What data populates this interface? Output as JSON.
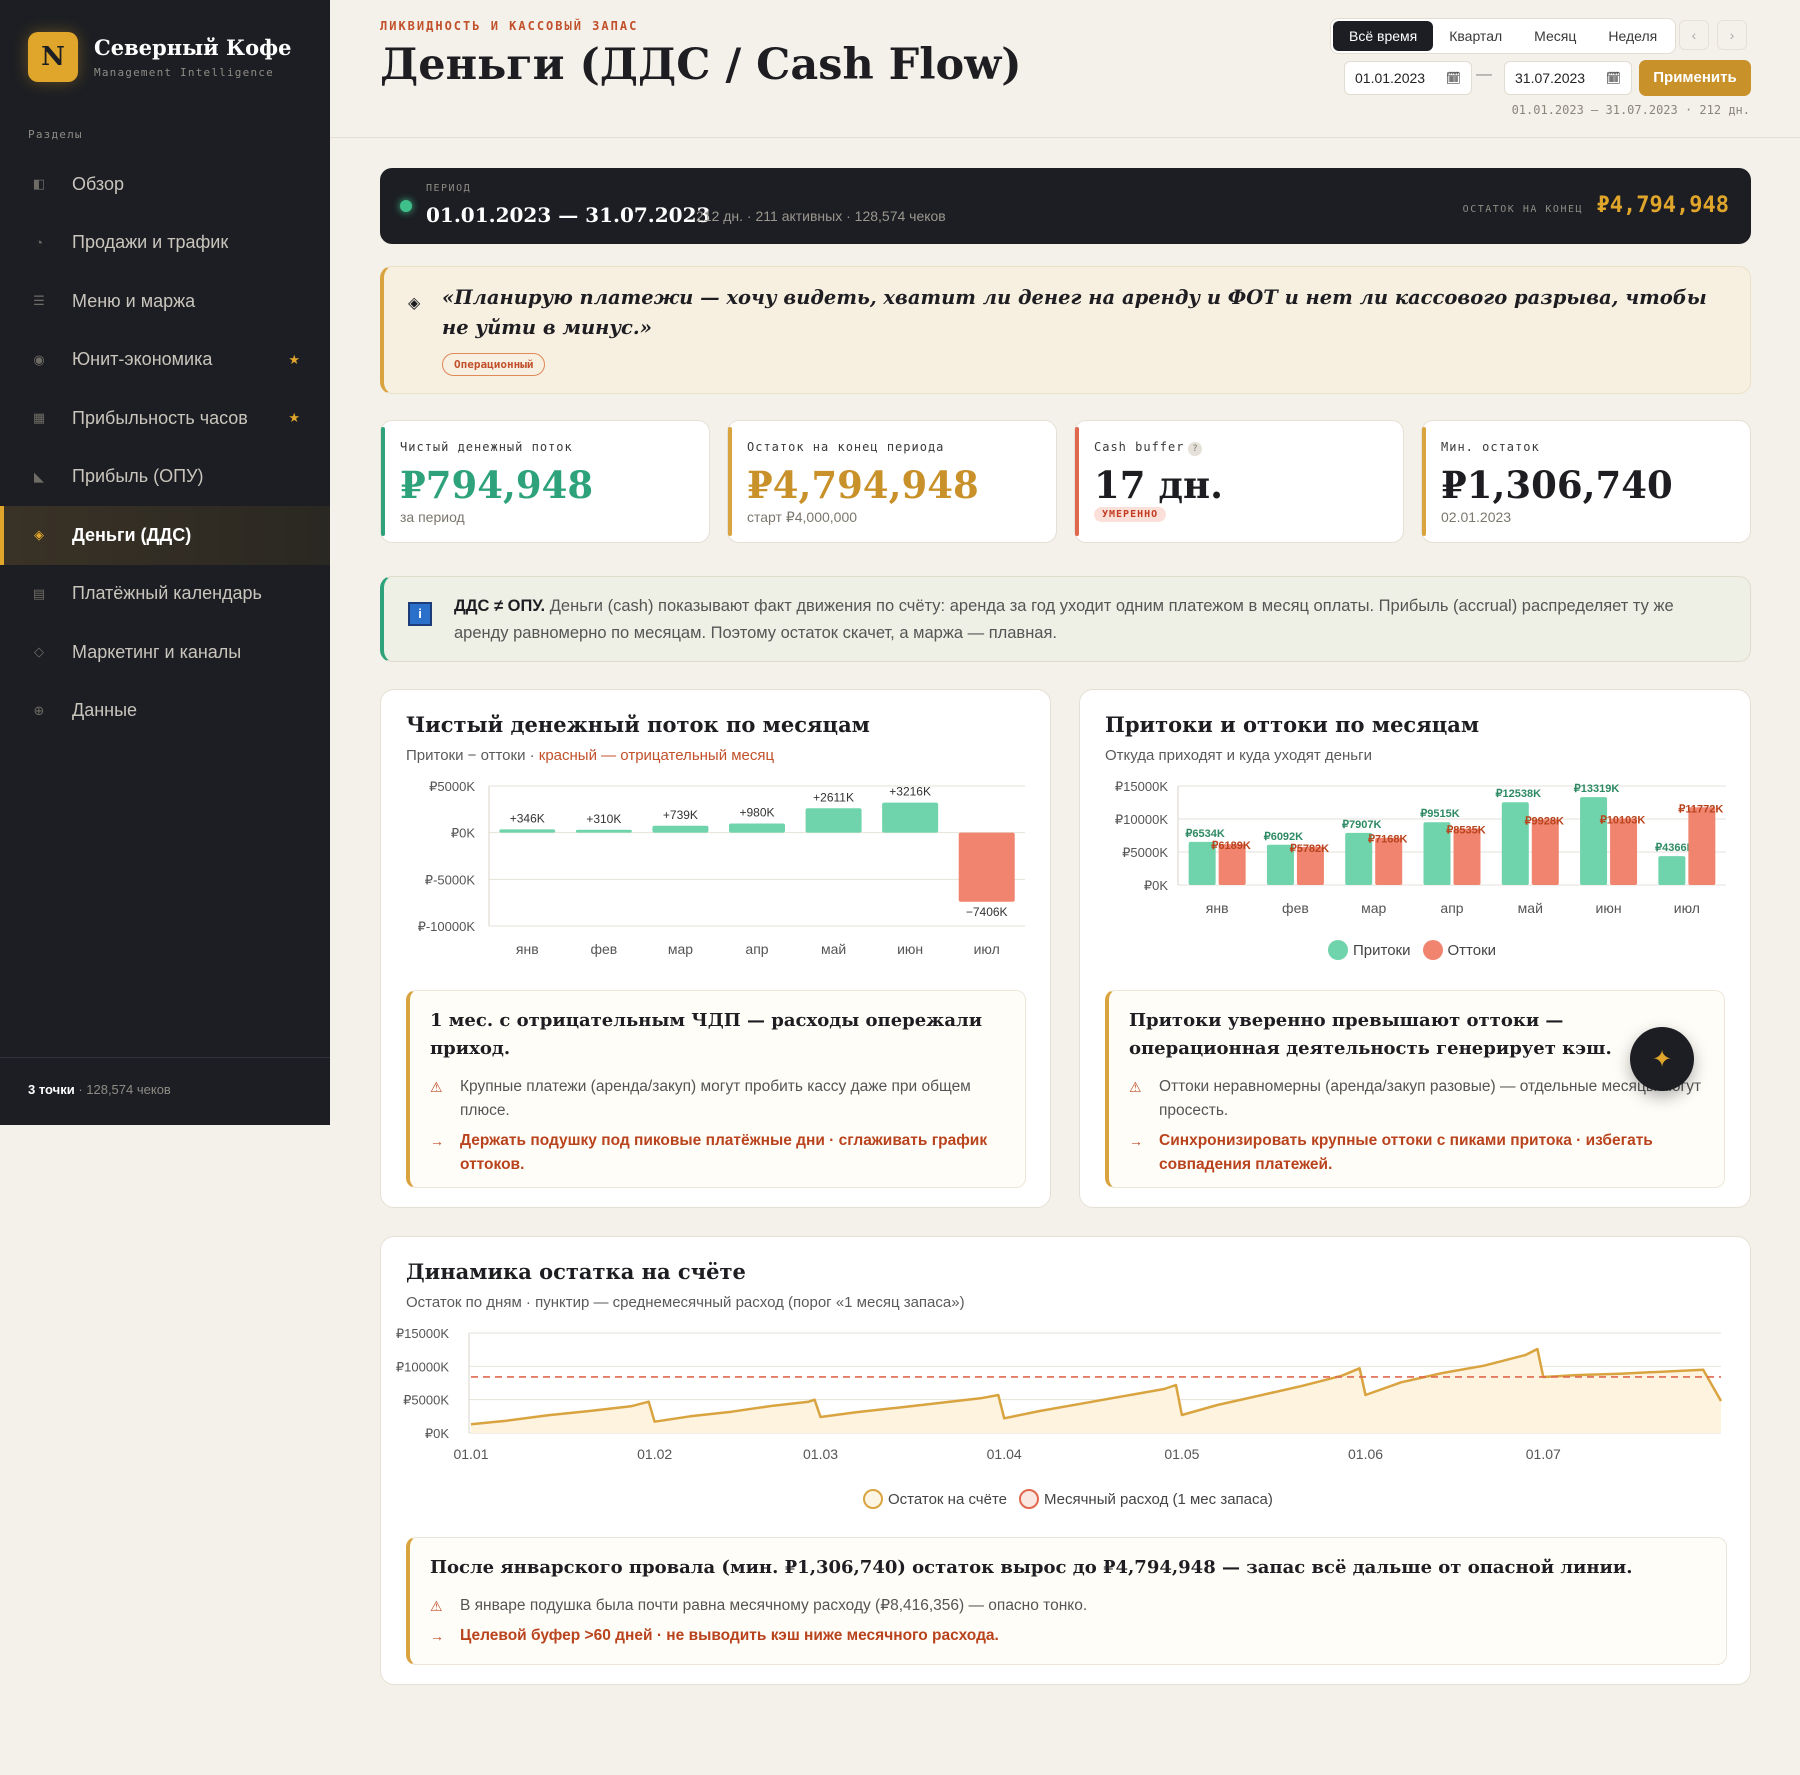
{
  "brand": {
    "logo": "N",
    "name": "Северный Кофе",
    "sub": "Management Intelligence"
  },
  "nav": {
    "title": "Разделы",
    "items": [
      {
        "label": "Обзор",
        "icon": "◧"
      },
      {
        "label": "Продажи и трафик",
        "icon": "◔"
      },
      {
        "label": "Меню и маржа",
        "icon": "☰"
      },
      {
        "label": "Юнит-экономика",
        "icon": "◉",
        "star": "★"
      },
      {
        "label": "Прибыльность часов",
        "icon": "▦",
        "star": "★"
      },
      {
        "label": "Прибыль (ОПУ)",
        "icon": "◣"
      },
      {
        "label": "Деньги (ДДС)",
        "icon": "◈",
        "active": true
      },
      {
        "label": "Платёжный календарь",
        "icon": "▤"
      },
      {
        "label": "Маркетинг и каналы",
        "icon": "◇"
      },
      {
        "label": "Данные",
        "icon": "⊕"
      }
    ],
    "footer_bold": "3 точки",
    "footer_rest": " · 128,574 чеков"
  },
  "header": {
    "eyebrow": "ЛИКВИДНОСТЬ И КАССОВЫЙ ЗАПАС",
    "title": "Деньги (ДДС / Cash Flow)",
    "segments": [
      "Всё время",
      "Квартал",
      "Месяц",
      "Неделя"
    ],
    "prev": "‹",
    "next": "›",
    "date_from": "01.01.2023",
    "date_to": "31.07.2023",
    "dash": "—",
    "apply": "Применить",
    "range_note": "01.01.2023 — 31.07.2023 · 212 дн."
  },
  "period": {
    "label": "ПЕРИОД",
    "range": "01.01.2023 — 31.07.2023",
    "meta": "212 дн. · 211 активных · 128,574 чеков",
    "end_label": "ОСТАТОК НА КОНЕЦ",
    "end_value": "₽4,794,948"
  },
  "quote": {
    "text": "«Планирую платежи — хочу видеть, хватит ли денег на аренду и ФОТ и нет ли кассового разрыва, чтобы не уйти в минус.»",
    "tag": "Операционный"
  },
  "kpis": [
    {
      "label": "Чистый денежный поток",
      "value": "₽794,948",
      "sub": "за период",
      "color": "#2ea37b"
    },
    {
      "label": "Остаток на конец периода",
      "value": "₽4,794,948",
      "sub": "старт ₽4,000,000",
      "color": "#c9912a"
    },
    {
      "label": "Cash buffer",
      "help": "?",
      "value": "17 дн.",
      "badge": "УМЕРЕННО",
      "color": "#1e1e22"
    },
    {
      "label": "Мин. остаток",
      "value": "₽1,306,740",
      "sub": "02.01.2023",
      "color": "#1e1e22"
    }
  ],
  "info": {
    "icon": "i",
    "bold": "ДДС ≠ ОПУ.",
    "text": " Деньги (cash) показывают факт движения по счёту: аренда за год уходит одним платежом в месяц оплаты. Прибыль (accrual) распределяет ту же аренду равномерно по месяцам. Поэтому остаток скачет, а маржа — плавная."
  },
  "net_card": {
    "title": "Чистый денежный поток по месяцам",
    "sub_plain": "Притоки − оттоки · ",
    "sub_hl": "красный — отрицательный месяц",
    "insight": {
      "title": "1 мес. с отрицательным ЧДП — расходы опережали приход.",
      "warn_icon": "⚠",
      "warn": "Крупные платежи (аренда/закуп) могут пробить кассу даже при общем плюсе.",
      "act_icon": "→",
      "act": "Держать подушку под пиковые платёжные дни · сглаживать график оттоков."
    }
  },
  "flow_card": {
    "title": "Притоки и оттоки по месяцам",
    "sub": "Откуда приходят и куда уходят деньги",
    "insight": {
      "title": "Притоки уверенно превышают оттоки — операционная деятельность генерирует кэш.",
      "warn_icon": "⚠",
      "warn": "Оттоки неравномерны (аренда/закуп разовые) — отдельные месяцы могут просесть.",
      "act_icon": "→",
      "act": "Синхронизировать крупные оттоки с пиками притока · избегать совпадения платежей."
    }
  },
  "balance_card": {
    "title": "Динамика остатка на счёте",
    "sub": "Остаток по дням · пунктир — среднемесячный расход (порог «1 месяц запаса»)",
    "insight": {
      "title": "После январского провала (мин. ₽1,306,740) остаток вырос до ₽4,794,948 — запас всё дальше от опасной линии.",
      "warn_icon": "⚠",
      "warn": "В январе подушка была почти равна месячному расходу (₽8,416,356) — опасно тонко.",
      "act_icon": "→",
      "act": "Целевой буфер >60 дней · не выводить кэш ниже месячного расхода."
    }
  },
  "fab": {
    "icon": "✦"
  },
  "chart_data": [
    {
      "type": "bar",
      "title": "Чистый денежный поток по месяцам",
      "categories": [
        "янв",
        "фев",
        "мар",
        "апр",
        "май",
        "июн",
        "июл"
      ],
      "values": [
        346,
        310,
        739,
        980,
        2611,
        3216,
        -7406
      ],
      "labels": [
        "+346K",
        "+310K",
        "+739K",
        "+980K",
        "+2611K",
        "+3216K",
        "−7406K"
      ],
      "ylim": [
        -10000,
        5000
      ],
      "yticks": [
        "₽5000K",
        "₽0K",
        "₽-5000K",
        "₽-10000K"
      ],
      "colors": {
        "positive": "#6fd3ab",
        "negative": "#f0846e"
      },
      "grid": true
    },
    {
      "type": "bar",
      "title": "Притоки и оттоки по месяцам",
      "categories": [
        "янв",
        "фев",
        "мар",
        "апр",
        "май",
        "июн",
        "июл"
      ],
      "series": [
        {
          "name": "Притоки",
          "values": [
            6534,
            6092,
            7907,
            9515,
            12538,
            13319,
            4366
          ],
          "labels": [
            "₽6534K",
            "₽6092K",
            "₽7907K",
            "₽9515K",
            "₽12538K",
            "₽13319K",
            "₽4366K"
          ],
          "color": "#6fd3ab",
          "label_color": "#2e8a64"
        },
        {
          "name": "Оттоки",
          "values": [
            6189,
            5782,
            7168,
            8535,
            9928,
            10103,
            11772
          ],
          "labels": [
            "₽6189K",
            "₽5782K",
            "₽7168K",
            "₽8535K",
            "₽9928K",
            "₽10103K",
            "₽11772K"
          ],
          "color": "#f0846e",
          "label_color": "#b9431d"
        }
      ],
      "ylim": [
        0,
        15000
      ],
      "yticks": [
        "₽15000K",
        "₽10000K",
        "₽5000K",
        "₽0K"
      ],
      "legend": "bottom",
      "grid": true
    },
    {
      "type": "area",
      "title": "Динамика остатка на счёте",
      "xticks": [
        "01.01",
        "01.02",
        "01.03",
        "01.04",
        "01.05",
        "01.06",
        "01.07"
      ],
      "series": [
        {
          "name": "Остаток на счёте",
          "color": "#d9a440",
          "x": [
            "01.01",
            "07.01",
            "14.01",
            "21.01",
            "28.01",
            "31.01",
            "01.02",
            "07.02",
            "14.02",
            "21.02",
            "27.02",
            "28.02",
            "01.03",
            "07.03",
            "14.03",
            "21.03",
            "28.03",
            "31.03",
            "01.04",
            "07.04",
            "14.04",
            "21.04",
            "28.04",
            "30.04",
            "01.05",
            "07.05",
            "14.05",
            "21.05",
            "28.05",
            "31.05",
            "01.06",
            "07.06",
            "14.06",
            "21.06",
            "28.06",
            "30.06",
            "01.07",
            "07.07",
            "14.07",
            "21.07",
            "28.07",
            "31.07"
          ],
          "y": [
            1307,
            1850,
            2650,
            3300,
            4000,
            4700,
            1700,
            2500,
            3200,
            4100,
            4700,
            5000,
            2400,
            3100,
            3800,
            4500,
            5200,
            5700,
            2200,
            3300,
            4400,
            5500,
            6600,
            7200,
            2700,
            4200,
            5600,
            7000,
            8600,
            9700,
            5700,
            7600,
            9000,
            10100,
            11700,
            12600,
            8400,
            8700,
            8900,
            9200,
            9500,
            4795
          ]
        },
        {
          "name": "Месячный расход (1 мес запаса)",
          "color": "#e0684e",
          "value": 8416
        }
      ],
      "ylim": [
        0,
        15000
      ],
      "yticks": [
        "₽15000K",
        "₽10000K",
        "₽5000K",
        "₽0K"
      ],
      "legend": "bottom",
      "grid": true
    }
  ]
}
